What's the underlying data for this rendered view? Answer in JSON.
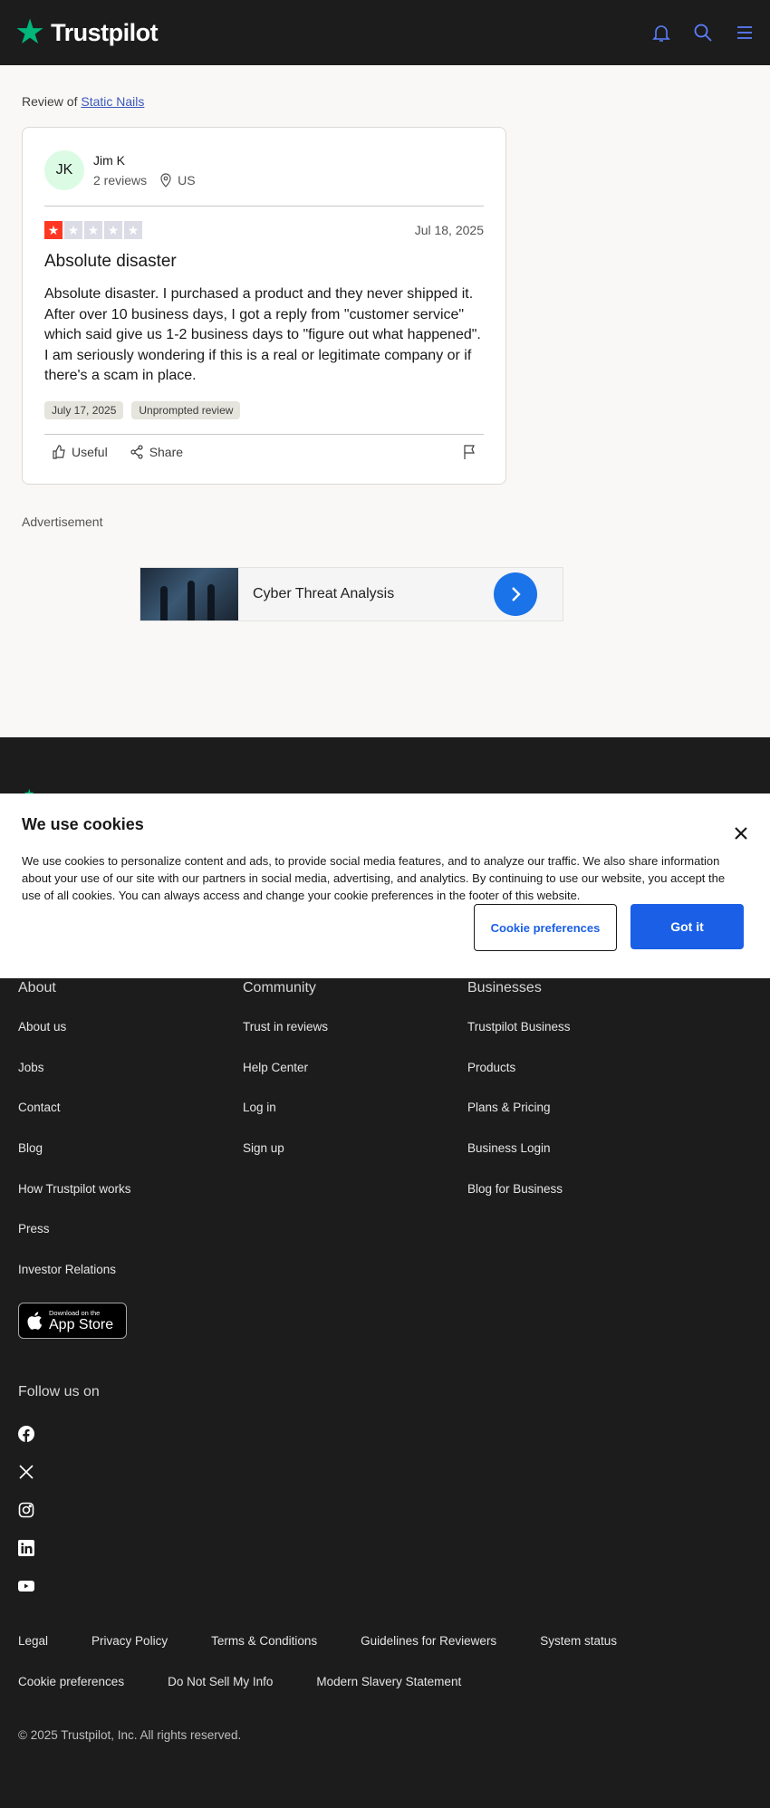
{
  "header": {
    "logo_text": "Trustpilot",
    "icons": [
      "bell-icon",
      "search-icon",
      "menu-icon"
    ]
  },
  "review_of": {
    "prefix": "Review of",
    "business": "Static Nails"
  },
  "review": {
    "avatar_initials": "JK",
    "author": "Jim K",
    "review_count": "2 reviews",
    "country": "US",
    "rating": 1,
    "max_rating": 5,
    "date": "Jul 18, 2025",
    "title": "Absolute disaster",
    "body": "Absolute disaster. I purchased a product and they never shipped it. After over 10 business days, I got a reply from \"customer service\" which said give us 1-2 business days to \"figure out what happened\". I am seriously wondering if this is a real or legitimate company or if there's a scam in place.",
    "tags": [
      "July 17, 2025",
      "Unprompted review"
    ],
    "useful_label": "Useful",
    "share_label": "Share"
  },
  "advertisement": {
    "label": "Advertisement",
    "ad_text": "Cyber Threat Analysis"
  },
  "cookie_banner": {
    "title": "We use cookies",
    "text": "We use cookies to personalize content and ads, to provide social media features, and to analyze our traffic. We also share information about your use of our site with our partners in social media, advertising, and analytics. By continuing to use our website, you accept the use of all cookies. You can always access and change your cookie preferences in the footer of this website.",
    "preferences_label": "Cookie preferences",
    "accept_label": "Got it"
  },
  "footer": {
    "columns": [
      {
        "title": "About",
        "links": [
          "About us",
          "Jobs",
          "Contact",
          "Blog",
          "How Trustpilot works",
          "Press",
          "Investor Relations"
        ]
      },
      {
        "title": "Community",
        "links": [
          "Trust in reviews",
          "Help Center",
          "Log in",
          "Sign up"
        ]
      },
      {
        "title": "Businesses",
        "links": [
          "Trustpilot Business",
          "Products",
          "Plans & Pricing",
          "Business Login",
          "Blog for Business"
        ]
      }
    ],
    "app_store_small": "Download on the",
    "app_store_big": "App Store",
    "follow_title": "Follow us on",
    "social": [
      "facebook-icon",
      "x-icon",
      "instagram-icon",
      "linkedin-icon",
      "youtube-icon"
    ],
    "legal_row1": [
      "Legal",
      "Privacy Policy",
      "Terms & Conditions",
      "Guidelines for Reviewers",
      "System status"
    ],
    "legal_row2": [
      "Cookie preferences",
      "Do Not Sell My Info",
      "Modern Slavery Statement"
    ],
    "copyright": "© 2025 Trustpilot, Inc. All rights reserved."
  },
  "colors": {
    "brand_green": "#00b67a",
    "star_red": "#ff3722",
    "star_empty": "#dcdce6",
    "accent_blue": "#1a5fe6"
  }
}
